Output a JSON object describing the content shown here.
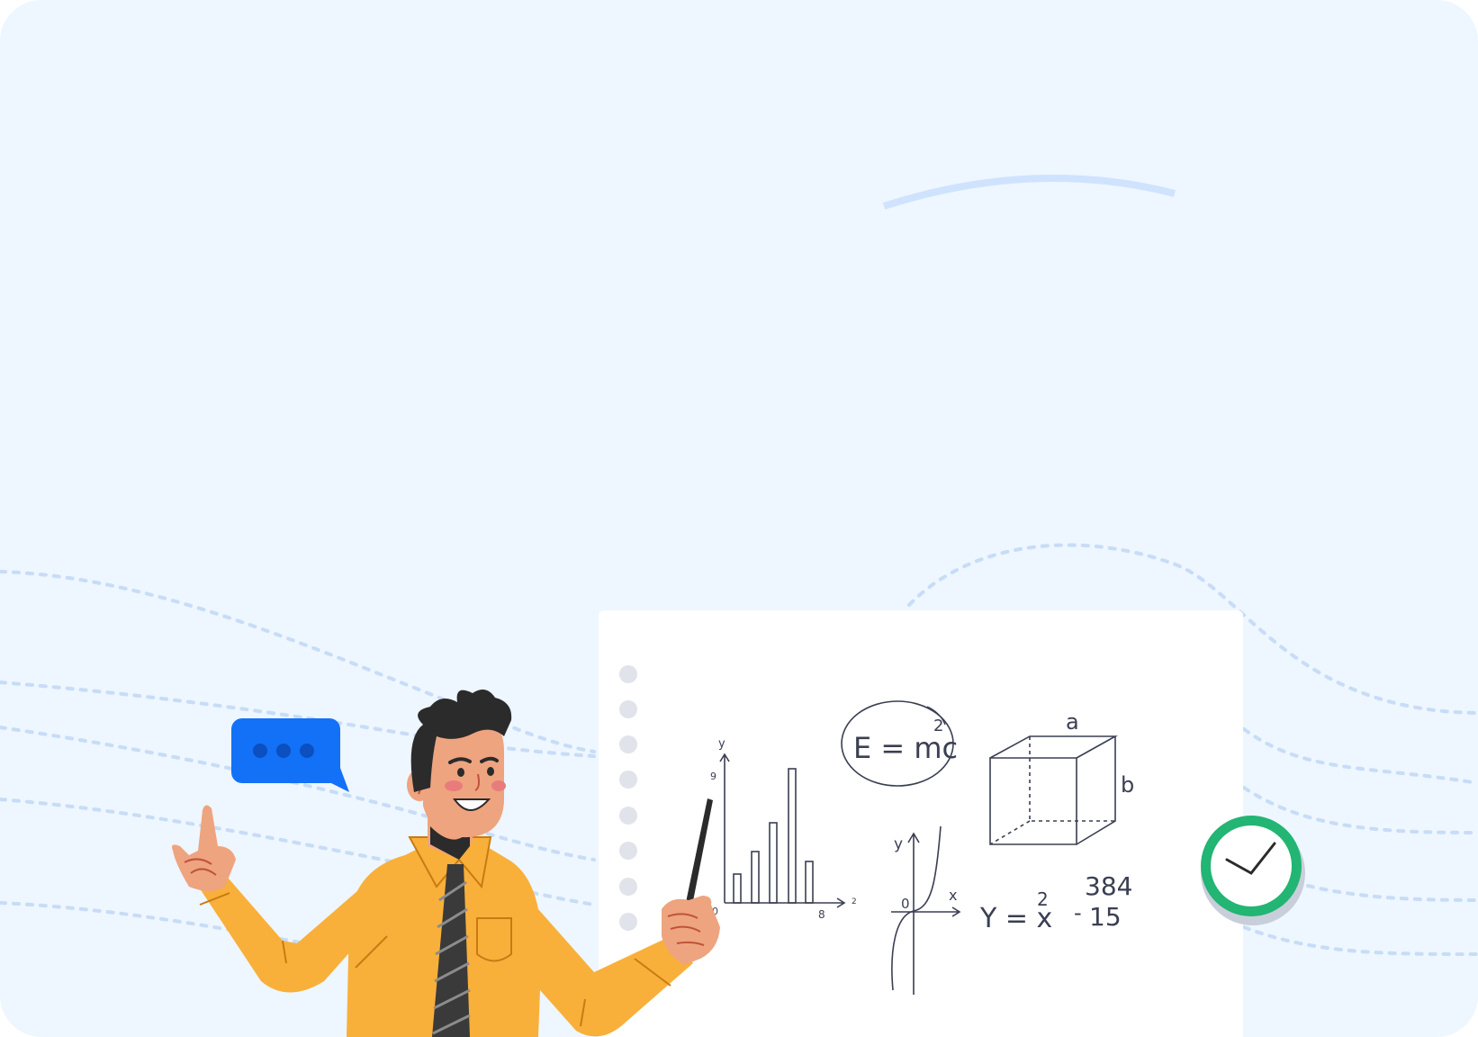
{
  "illustration": {
    "whiteboard": {
      "formula_einstein": "E = mc",
      "formula_einstein_exp": "2",
      "cube_label_a": "a",
      "cube_label_b": "b",
      "bar_chart": {
        "y_axis_label": "y",
        "y_tick": "9",
        "origin": "0",
        "x_tick": "8",
        "x_end": "2"
      },
      "parabola_graph": {
        "y_axis_label": "y",
        "x_axis_label": "x",
        "origin": "0"
      },
      "equation": "Y = x",
      "equation_exp": "2",
      "arith_top": "384",
      "arith_op": "-",
      "arith_bottom": "15"
    },
    "colors": {
      "background": "#eef6ff",
      "shirt": "#f8b03a",
      "chat_bubble": "#1271f7",
      "clock_ring": "#22b573",
      "skin": "#eea47f",
      "hair": "#2b2b2b"
    },
    "icons": [
      "chat-bubble-icon",
      "clock-icon"
    ]
  }
}
